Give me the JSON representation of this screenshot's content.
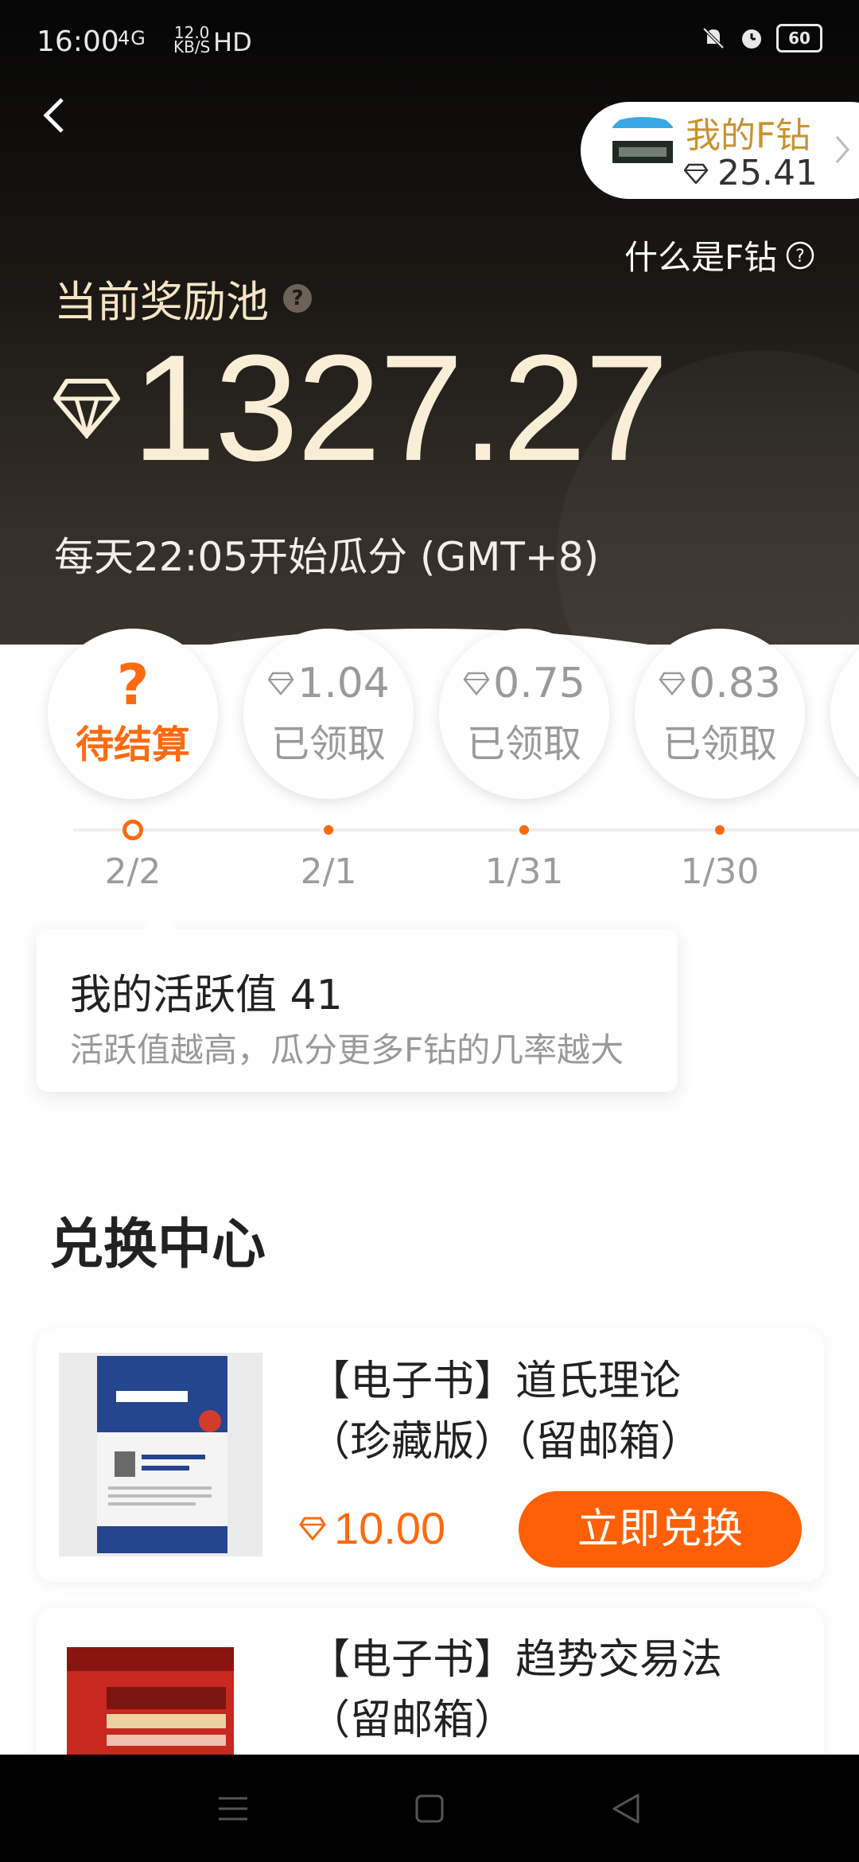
{
  "status_bar": {
    "time": "16:00",
    "network": "4G",
    "speed_value": "12.0",
    "speed_unit": "KB/S",
    "hd": "HD",
    "battery": "60"
  },
  "header": {
    "wallet_title": "我的F钻",
    "wallet_balance": "25.41",
    "what_is_link": "什么是F钻",
    "pool_label": "当前奖励池",
    "pool_help": "?",
    "pool_value": "1327.27",
    "pool_note": "每天22:05开始瓜分 (GMT+8)"
  },
  "days": [
    {
      "date": "2/2",
      "amount": "?",
      "status": "待结算",
      "active": true
    },
    {
      "date": "2/1",
      "amount": "1.04",
      "status": "已领取",
      "active": false
    },
    {
      "date": "1/31",
      "amount": "0.75",
      "status": "已领取",
      "active": false
    },
    {
      "date": "1/30",
      "amount": "0.83",
      "status": "已领取",
      "active": false
    }
  ],
  "tooltip": {
    "title": "我的活跃值 41",
    "subtitle": "活跃值越高，瓜分更多F钻的几率越大"
  },
  "exchange": {
    "section_title": "兑换中心",
    "items": [
      {
        "title_line1": "【电子书】道氏理论",
        "title_line2": "（珍藏版）（留邮箱）",
        "price": "10.00",
        "button": "立即兑换"
      },
      {
        "title_line1": "【电子书】趋势交易法",
        "title_line2": "（留邮箱）"
      }
    ]
  },
  "colors": {
    "accent": "#ff6a10",
    "gold": "#c8932f",
    "hero_text": "#fbeed6"
  }
}
